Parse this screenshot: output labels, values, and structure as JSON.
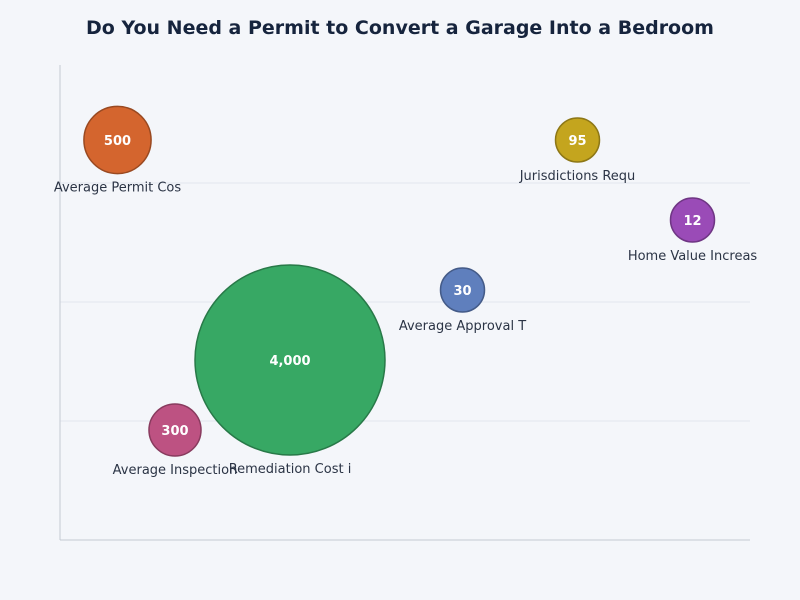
{
  "chart_data": {
    "type": "scatter",
    "title": "Do You Need a Permit to Convert a Garage Into a Bedroom",
    "xlabel": "",
    "ylabel": "",
    "grid": true,
    "points": [
      {
        "label": "Average Permit Cos",
        "value_label": "500",
        "value": 500,
        "x": 1,
        "y": 4,
        "color": "#d4652e"
      },
      {
        "label": "Jurisdictions Requ",
        "value_label": "95",
        "value": 95,
        "x": 5,
        "y": 4,
        "color": "#c4a51e"
      },
      {
        "label": "Home Value Increas",
        "value_label": "12",
        "value": 12,
        "x": 6,
        "y": 3.2,
        "color": "#9a4bb7"
      },
      {
        "label": "Average Approval T",
        "value_label": "30",
        "value": 30,
        "x": 4,
        "y": 2.5,
        "color": "#5f7fbd"
      },
      {
        "label": "Remediation Cost i",
        "value_label": "4,000",
        "value": 4000,
        "x": 2.5,
        "y": 1.8,
        "color": "#37a864"
      },
      {
        "label": "Average Inspection",
        "value_label": "300",
        "value": 300,
        "x": 1.5,
        "y": 1.1,
        "color": "#bd5282"
      }
    ]
  }
}
